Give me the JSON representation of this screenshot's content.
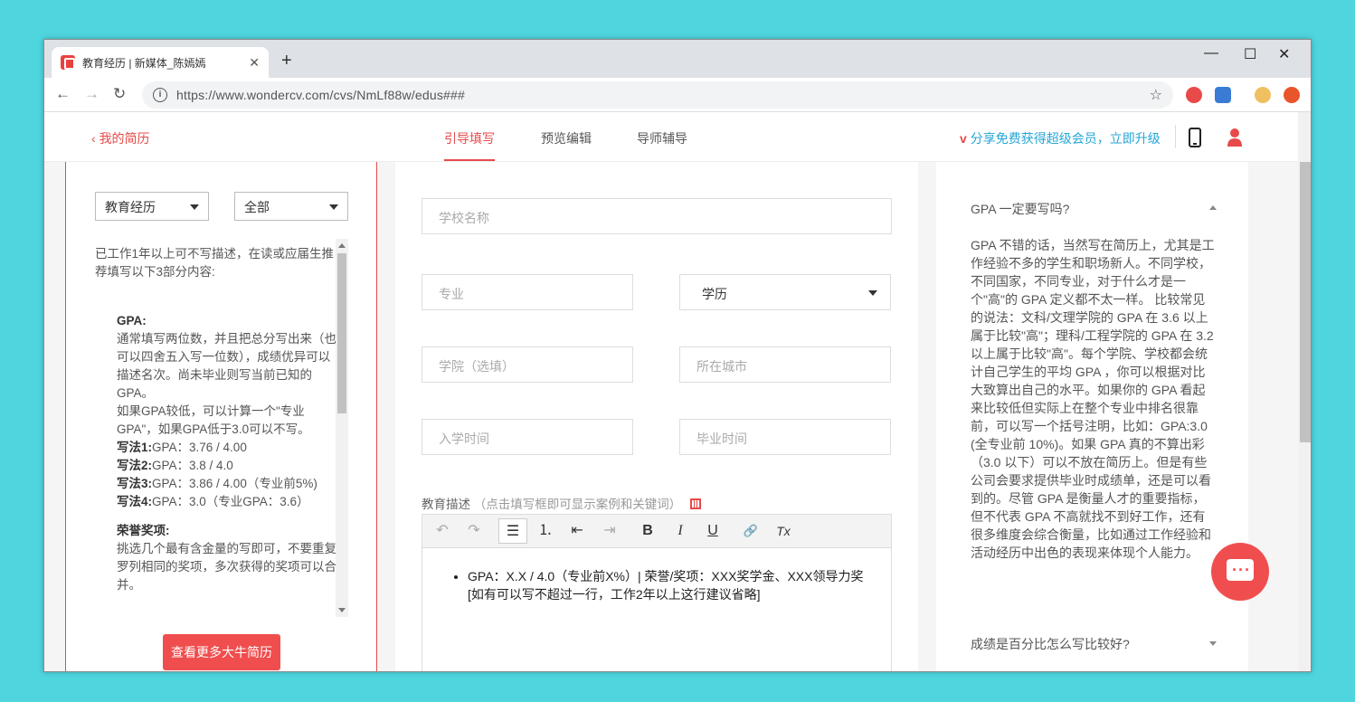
{
  "browser": {
    "tab_title": "教育经历 | 新媒体_陈嫣嫣",
    "url": "https://www.wondercv.com/cvs/NmLf88w/edus###"
  },
  "topnav": {
    "back_label": "我的简历",
    "tabs": [
      "引导填写",
      "预览编辑",
      "导师辅导"
    ],
    "active_tab": "引导填写",
    "promo": "分享免费获得超级会员，立即升级"
  },
  "left": {
    "select_section": "教育经历",
    "select_filter": "全部",
    "intro": "已工作1年以上可不写描述，在读或应届生推荐填写以下3部分内容:",
    "gpa_heading": "GPA:",
    "gpa_text1": "通常填写两位数，并且把总分写出来（也可以四舍五入写一位数），成绩优异可以描述名次。尚未毕业则写当前已知的GPA。",
    "gpa_text2": "如果GPA较低，可以计算一个\"专业GPA\"，如果GPA低于3.0可以不写。",
    "examples": [
      {
        "label": "写法1:",
        "text": "GPA：3.76 / 4.00"
      },
      {
        "label": "写法2:",
        "text": "GPA：3.8 / 4.0"
      },
      {
        "label": "写法3:",
        "text": "GPA：3.86 / 4.00（专业前5%)"
      },
      {
        "label": "写法4:",
        "text": "GPA：3.0（专业GPA：3.6）"
      }
    ],
    "honor_heading": "荣誉奖项:",
    "honor_text": "挑选几个最有含金量的写即可，不要重复罗列相同的奖项，多次获得的奖项可以合并。",
    "more_button": "查看更多大牛简历"
  },
  "form": {
    "school_placeholder": "学校名称",
    "major_placeholder": "专业",
    "degree_select": "学历",
    "college_placeholder": "学院（选填）",
    "city_placeholder": "所在城市",
    "start_placeholder": "入学时间",
    "end_placeholder": "毕业时间",
    "desc_label": "教育描述",
    "desc_hint": "（点击填写框即可显示案例和关键词）",
    "editor_line1": "GPA：X.X / 4.0（专业前X%）| 荣誉/奖项：XXX奖学金、XXX领导力奖",
    "editor_line2": "[如有可以写不超过一行，工作2年以上这行建议省略]"
  },
  "toolbar": {
    "undo": "↶",
    "redo": "↷",
    "bullets": "☰",
    "numbers": "⒈",
    "outdent": "⇤",
    "indent": "⇥",
    "bold": "B",
    "italic": "I",
    "underline": "U",
    "link": "🔗",
    "clear": "Tx"
  },
  "faq": {
    "q1": "GPA 一定要写吗?",
    "a1": "GPA 不错的话，当然写在简历上，尤其是工作经验不多的学生和职场新人。不同学校，不同国家，不同专业，对于什么才是一个\"高\"的 GPA 定义都不太一样。 比较常见的说法：文科/文理学院的 GPA 在 3.6 以上属于比较\"高\"；理科/工程学院的 GPA 在 3.2 以上属于比较\"高\"。每个学院、学校都会统计自己学生的平均 GPA ，你可以根据对比大致算出自己的水平。如果你的 GPA 看起来比较低但实际上在整个专业中排名很靠前，可以写一个括号注明，比如：GPA:3.0 (全专业前 10%)。如果 GPA 真的不算出彩（3.0 以下）可以不放在简历上。但是有些公司会要求提供毕业时成绩单，还是可以看到的。尽管 GPA 是衡量人才的重要指标，但不代表 GPA 不高就找不到好工作，还有很多维度会综合衡量，比如通过工作经验和活动经历中出色的表现来体现个人能力。",
    "q2": "成绩是百分比怎么写比较好?"
  },
  "colors": {
    "accent": "#e84a4a",
    "promo": "#26a6d6",
    "desktop": "#4fd5de"
  }
}
